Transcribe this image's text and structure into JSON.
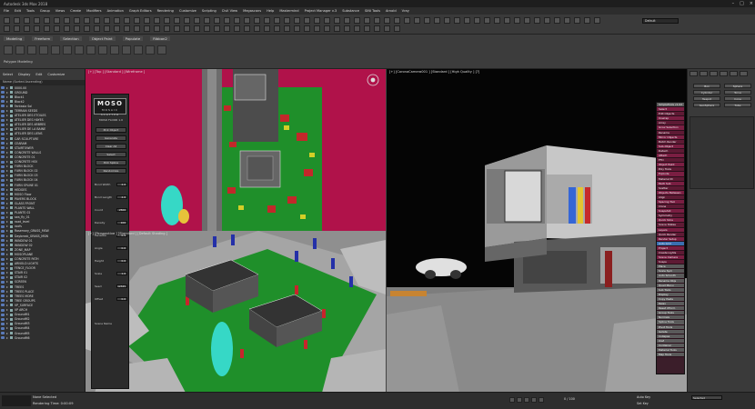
{
  "window": {
    "title": "Autodesk 3ds Max 2018",
    "min_icon": "minimize-icon",
    "max_icon": "maximize-icon",
    "close_icon": "close-icon"
  },
  "menu": [
    "File",
    "Edit",
    "Tools",
    "Group",
    "Views",
    "Create",
    "Modifiers",
    "Animation",
    "Graph Editors",
    "Rendering",
    "Customize",
    "Scripting",
    "Civil View",
    "Megascans",
    "Help",
    "Mastermind",
    "Project Manager v.3",
    "Substance",
    "SiNi Tools",
    "Arnold",
    "Vray"
  ],
  "workspace": {
    "label": "Workspaces:",
    "value": "Default"
  },
  "ribbon": {
    "tabs": [
      "Modeling",
      "Freeform",
      "Selection",
      "Object Paint",
      "Populate",
      "Ribbon2"
    ],
    "sub_label": "Polygon Modeling"
  },
  "scene_explorer": {
    "tabs": [
      "Select",
      "Display",
      "Edit",
      "Customize"
    ],
    "header": "Name (Sorted Ascending)",
    "items": [
      "0000.00",
      "GROUND",
      "Block1",
      "Block2",
      "Fantasia Sol",
      "TERRAIN SEEDS",
      "ATELIER DES ETOILES",
      "ATELIER DES HAYES",
      "ATELIER DES ARBRES",
      "ATELIER DE LA BAINE",
      "ATELIER DES LIENS",
      "CAR SCULPTURE",
      "CEARAM",
      "STAIRTOWER",
      "CONCRETE WALLS",
      "CONCRETE 01",
      "CONCRETE HSV",
      "FURN BLOCK",
      "FURN BLOCK 02",
      "FURN BLOCK 03",
      "FURN BLOCK 04",
      "FURN SPLINE 01",
      "HEDGES",
      "MOSO Floor",
      "PAVERS BLOCK",
      "GLASS FRONT",
      "PLANTS WALL",
      "PLANTS 02",
      "sea_fly_01",
      "road_level",
      "roofs",
      "Rosemary_GRASS_MSW",
      "Daybreak_GRASS_MSW",
      "WINDOW 01",
      "WINDOW 02",
      "ZONE_MAP",
      "MOSOPLANE",
      "CONCRETE PATH",
      "ARNOLD LIGHTS",
      "FENCE_FLOOR",
      "STAIR 01",
      "STAIR 02",
      "SCREEN",
      "TREES",
      "TREES PLACE",
      "TREES MORE",
      "TREE GROUPS",
      "VP_SURFACE",
      "VP ARCH",
      "GroundM1",
      "GroundM2",
      "GroundM3",
      "GroundM4",
      "GroundM5",
      "GroundM6"
    ]
  },
  "viewports": {
    "top": "[+] [Top ] [Standard ] [Wireframe ]",
    "persp": "[+] [Perspective ] [Standard ] [Default Shading ]",
    "camera": "[+] [CoronaCamera001 ] [Standard ] [High Quality ] [?]"
  },
  "moso": {
    "logo": "MOSO",
    "logo_sub": "MOSAIC SCATTER",
    "subtitle": "MOSO FLOOR 1.0",
    "buttons": [
      "Pick Object",
      "Generate",
      "Clear All",
      "Select",
      "Pick Spline",
      "Randomize"
    ],
    "params": [
      {
        "label": "Bond Width",
        "value": "2.0"
      },
      {
        "label": "Bond Length",
        "value": "2.0"
      },
      {
        "label": "Count",
        "value": "2500"
      },
      {
        "label": "Density",
        "value": "100"
      },
      {
        "label": "Variation",
        "value": "0.5"
      },
      {
        "label": "Angle",
        "value": "0.0"
      },
      {
        "label": "Height",
        "value": "0.0"
      },
      {
        "label": "Scale",
        "value": "1.0"
      },
      {
        "label": "Seed",
        "value": "12345"
      },
      {
        "label": "Offset",
        "value": "0.0"
      }
    ],
    "footer": "Scene Name"
  },
  "command_panel": {
    "tabs": [
      "create-tab",
      "modify-tab",
      "hierarchy-tab",
      "motion-tab",
      "display-tab",
      "utilities-tab"
    ],
    "buttons": [
      "Box",
      "Sphere",
      "Cylinder",
      "Torus",
      "Teapot",
      "Cone",
      "GeoSphere",
      "Tube"
    ]
  },
  "plugin_list": {
    "title": "SimpleTools v1.02",
    "items": [
      "Select",
      "Edit Objects",
      "Unwrap",
      "Array",
      "Grow Selection",
      "Rename",
      "Mirror Objects",
      "Batch Render",
      "Sub-Object",
      "Detach",
      "Attach",
      "FFD",
      "Object Paint",
      "Poly Tools",
      "Explode",
      "Material ID",
      "Multi Sub",
      "Scatter",
      "Objects Between",
      "Align",
      "Spacing Tool",
      "Clone",
      "Snapshot",
      "Symmetry",
      "Quick Slice",
      "Scene States",
      "Layers",
      "Quick Render",
      "Render Setup",
      "Auto Grid",
      "Project",
      "Create Lights",
      "Scene Camera",
      "Snaps",
      "Place",
      "Scale Sym",
      "Auto Smooth",
      "Rename Objs",
      "Quad Menu",
      "Sub Tools",
      "Display",
      "Copy Paste",
      "Relax",
      "Reset XForm",
      "Group Tools",
      "Normals",
      "Spline Tools",
      "Pivot Tools",
      "Isolate",
      "Collapse",
      "Xref",
      "Container",
      "Material Tools",
      "Map Tools"
    ]
  },
  "status": {
    "line1": "None Selected",
    "line2": "Rendering Time: 0:00:09",
    "key_label": "Set Key",
    "auto_key": "Auto Key",
    "selected": "Selected",
    "time": "0 / 100"
  }
}
